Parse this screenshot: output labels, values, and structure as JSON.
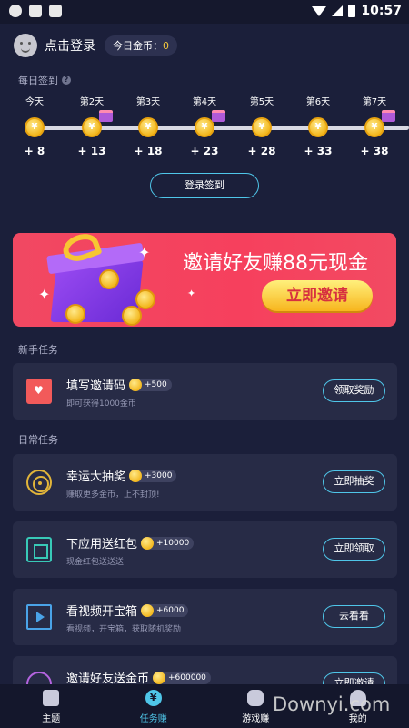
{
  "status_bar": {
    "time": "10:57"
  },
  "user": {
    "login_label": "点击登录",
    "coins_label": "今日金币：",
    "coins_value": "0"
  },
  "checkin": {
    "title": "每日签到",
    "days": [
      {
        "label": "今天",
        "reward": "+ 8",
        "gift": false
      },
      {
        "label": "第2天",
        "reward": "+ 13",
        "gift": true
      },
      {
        "label": "第3天",
        "reward": "+ 18",
        "gift": false
      },
      {
        "label": "第4天",
        "reward": "+ 23",
        "gift": true
      },
      {
        "label": "第5天",
        "reward": "+ 28",
        "gift": false
      },
      {
        "label": "第6天",
        "reward": "+ 33",
        "gift": false
      },
      {
        "label": "第7天",
        "reward": "+ 38",
        "gift": true
      }
    ],
    "button_label": "登录签到"
  },
  "banner": {
    "title": "邀请好友赚88元现金",
    "button_label": "立即邀请"
  },
  "sections": {
    "newbie": "新手任务",
    "daily": "日常任务"
  },
  "tasks": [
    {
      "title": "填写邀请码",
      "reward": "+500",
      "desc": "即可获得1000金币",
      "button": "领取奖励",
      "icon": "invite-code-icon"
    },
    {
      "title": "幸运大抽奖",
      "reward": "+3000",
      "desc": "赚取更多金币，上不封顶!",
      "button": "立即抽奖",
      "icon": "lucky-wheel-icon"
    },
    {
      "title": "下应用送红包",
      "reward": "+10000",
      "desc": "现金红包送送送",
      "button": "立即领取",
      "icon": "app-download-icon"
    },
    {
      "title": "看视频开宝箱",
      "reward": "+6000",
      "desc": "看视频，开宝箱，获取随机奖励",
      "button": "去看看",
      "icon": "video-icon"
    },
    {
      "title": "邀请好友送金币",
      "reward": "+600000",
      "desc": "",
      "button": "立即邀请",
      "icon": "invite-friend-icon"
    }
  ],
  "tabbar": [
    {
      "label": "主题",
      "icon": "shirt-icon",
      "active": false
    },
    {
      "label": "任务赚",
      "icon": "yuan-icon",
      "active": true
    },
    {
      "label": "游戏赚",
      "icon": "gamepad-icon",
      "active": false
    },
    {
      "label": "我的",
      "icon": "person-icon",
      "active": false
    }
  ],
  "watermark": "Downyi.com",
  "colors": {
    "background": "#1b1f3a",
    "card": "#272b46",
    "accent": "#4fc6e9",
    "coin": "#f3b81f",
    "banner": "#f14862"
  }
}
